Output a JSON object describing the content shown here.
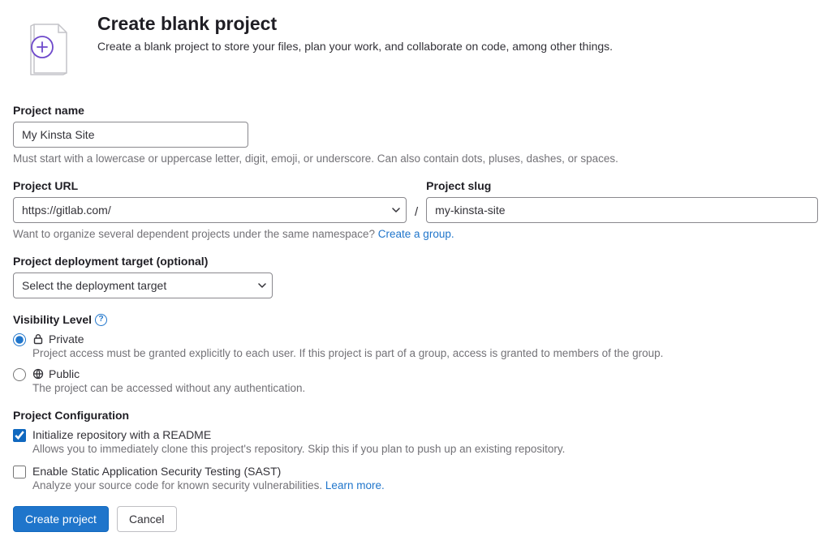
{
  "header": {
    "title": "Create blank project",
    "subtitle": "Create a blank project to store your files, plan your work, and collaborate on code, among other things."
  },
  "project_name": {
    "label": "Project name",
    "value": "My Kinsta Site",
    "help": "Must start with a lowercase or uppercase letter, digit, emoji, or underscore. Can also contain dots, pluses, dashes, or spaces."
  },
  "project_url": {
    "label": "Project URL",
    "value": "https://gitlab.com/",
    "namespace_help_prefix": "Want to organize several dependent projects under the same namespace? ",
    "namespace_link": "Create a group."
  },
  "project_slug": {
    "label": "Project slug",
    "value": "my-kinsta-site"
  },
  "deployment_target": {
    "label": "Project deployment target (optional)",
    "placeholder": "Select the deployment target"
  },
  "visibility": {
    "label": "Visibility Level",
    "options": [
      {
        "title": "Private",
        "desc": "Project access must be granted explicitly to each user. If this project is part of a group, access is granted to members of the group.",
        "selected": true
      },
      {
        "title": "Public",
        "desc": "The project can be accessed without any authentication.",
        "selected": false
      }
    ]
  },
  "configuration": {
    "label": "Project Configuration",
    "readme": {
      "title": "Initialize repository with a README",
      "desc": "Allows you to immediately clone this project's repository. Skip this if you plan to push up an existing repository.",
      "checked": true
    },
    "sast": {
      "title": "Enable Static Application Security Testing (SAST)",
      "desc_prefix": "Analyze your source code for known security vulnerabilities. ",
      "learn_more": "Learn more.",
      "checked": false
    }
  },
  "buttons": {
    "create": "Create project",
    "cancel": "Cancel"
  }
}
